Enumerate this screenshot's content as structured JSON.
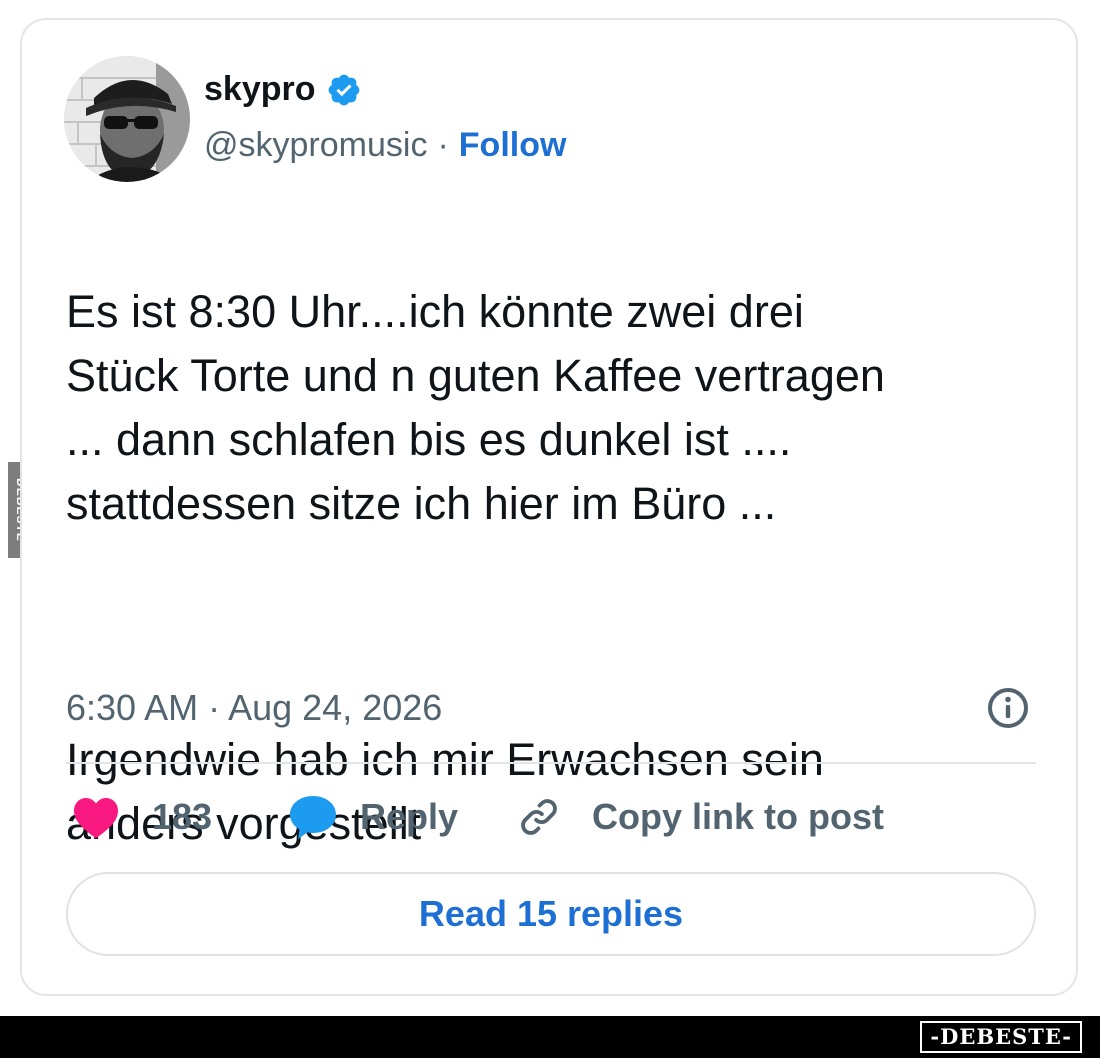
{
  "author": {
    "name": "skypro",
    "handle": "@skypromusic",
    "separator": "·",
    "follow_label": "Follow",
    "verified": true
  },
  "tweet": {
    "text_paragraph_1": "Es ist 8:30 Uhr....ich könnte zwei drei\nStück Torte und n guten Kaffee vertragen\n... dann schlafen bis es dunkel ist ....\nstattdessen sitze ich hier im Büro ...",
    "text_paragraph_2": "Irgendwie hab ich mir Erwachsen sein\nanders vorgestellt",
    "timestamp": "6:30 AM · Aug 24, 2026"
  },
  "actions": {
    "like_count": "183",
    "reply_label": "Reply",
    "copy_link_label": "Copy link to post"
  },
  "read_replies_label": "Read 15 replies",
  "watermark": {
    "side": "DEBESTE",
    "logo": "-DEBESTE-"
  },
  "colors": {
    "accent": "#1d6fd4",
    "like": "#f91880",
    "reply_icon": "#1d9bf0",
    "muted": "#536471"
  },
  "icons": [
    "avatar-photo",
    "verified-badge-icon",
    "info-icon",
    "heart-icon",
    "speech-bubble-icon",
    "link-icon"
  ]
}
